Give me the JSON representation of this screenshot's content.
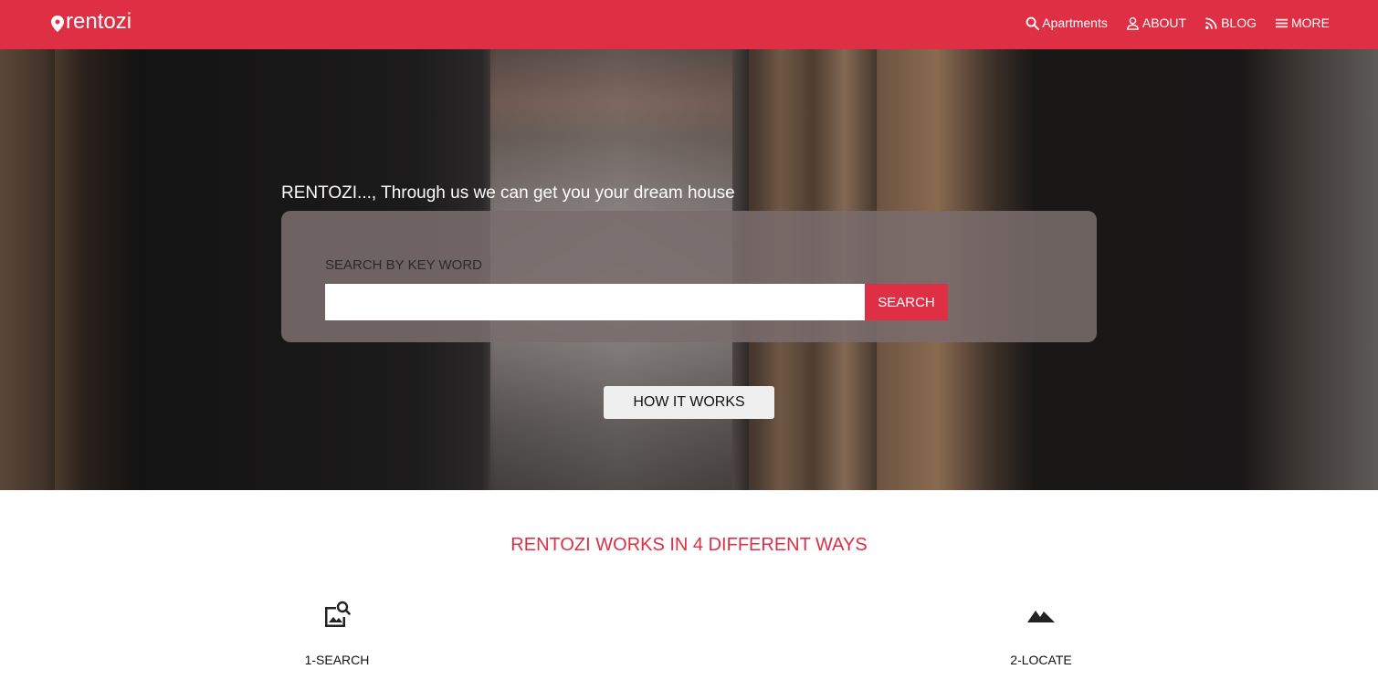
{
  "brand": {
    "name": "rentozi",
    "icon": "map-pin-icon"
  },
  "nav": {
    "items": [
      {
        "label": "Apartments",
        "icon": "search-icon"
      },
      {
        "label": "ABOUT",
        "icon": "user-icon"
      },
      {
        "label": "BLOG",
        "icon": "rss-icon"
      },
      {
        "label": "MORE",
        "icon": "menu-icon"
      }
    ]
  },
  "hero": {
    "tagline": "RENTOZI..., Through us we can get you your dream house",
    "search_label": "SEARCH BY KEY WORD",
    "search_value": "",
    "search_button": "SEARCH",
    "how_button": "HOW IT WORKS"
  },
  "ways": {
    "title": "RENTOZI WORKS IN 4 DIFFERENT WAYS",
    "items": [
      {
        "label": "1-SEARCH",
        "icon": "image-search-icon"
      },
      {
        "label": "2-LOCATE",
        "icon": "mountains-icon"
      }
    ]
  },
  "colors": {
    "brand": "#df2f44",
    "panel": "#7a6c6c",
    "hero_dark": "#1e1c1c"
  }
}
